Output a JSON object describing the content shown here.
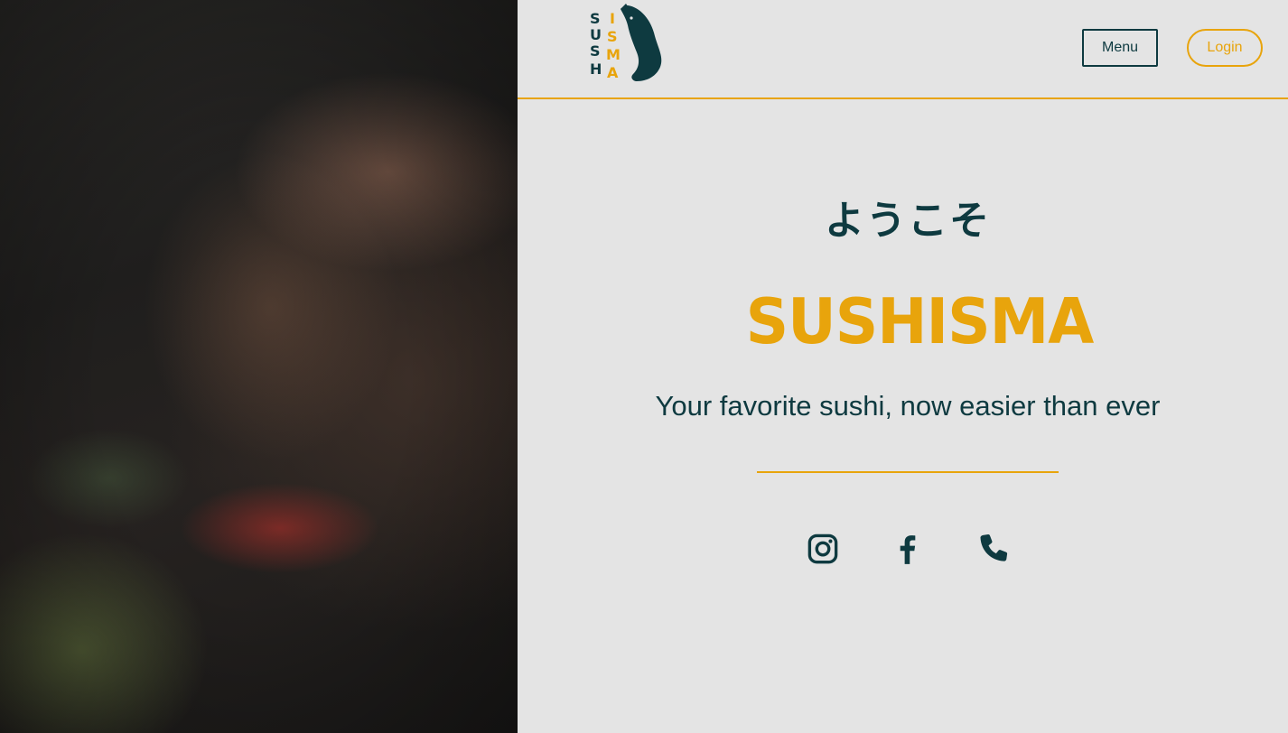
{
  "hero_image": {
    "description": "blurred dark photo of a sushi chef preparing nigiri with wasabi"
  },
  "header": {
    "logo_text_left": "SUSH",
    "logo_text_right": "ISMA",
    "menu_label": "Menu",
    "login_label": "Login"
  },
  "main": {
    "welcome": "ようこそ",
    "brand": "SUSHISMA",
    "tagline": "Your favorite sushi, now easier than ever"
  },
  "social": [
    {
      "name": "instagram-icon"
    },
    {
      "name": "facebook-icon"
    },
    {
      "name": "phone-icon"
    }
  ],
  "colors": {
    "accent": "#e8a40c",
    "primary": "#0e3a40",
    "background": "#e4e4e4"
  }
}
